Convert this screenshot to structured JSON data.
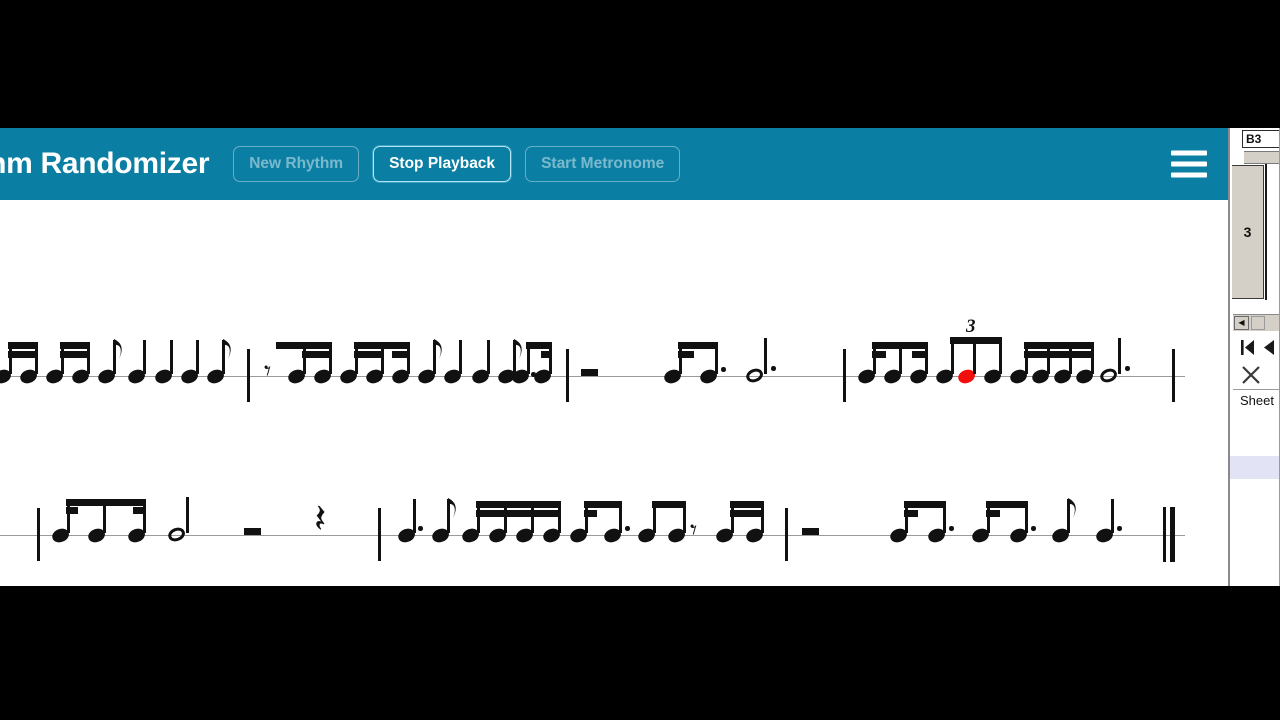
{
  "app": {
    "title": "ythm Randomizer",
    "header_color": "#0b7fa3",
    "buttons": [
      {
        "label": "New Rhythm",
        "name": "new-rhythm-button",
        "state": "idle"
      },
      {
        "label": "Stop Playback",
        "name": "stop-playback-button",
        "state": "active"
      },
      {
        "label": "Start Metronome",
        "name": "start-metronome-button",
        "state": "idle"
      }
    ],
    "menu_icon": "hamburger-menu-icon"
  },
  "score": {
    "staff_type": "single-line rhythm staff",
    "playing_note_color": "#f40d0d",
    "tuplet_label": "3",
    "systems": [
      {
        "index": 1,
        "measures": [
          "four sixteenth notes beamed, eighth note, quarter note, quarter note, quarter note, eighth note",
          "eighth rest, two sixteenths beamed, four sixteenths beamed, eighth, quarter, quarter, eighth, dotted eighth + sixteenth",
          "half rest, two eighths beamed with dot, dotted half note",
          "four sixteenths beamed, eighth-note triplet (bracket 3) with red playing note, four sixteenths beamed, dotted half note"
        ]
      },
      {
        "index": 2,
        "measures": [
          "three eighths beamed, half note, half rest, quarter rest",
          "dotted quarter, eighth, six sixteenths beamed, dotted eighth + sixteenth, two eighths beamed, eighth rest, two sixteenths beamed",
          "half rest, dotted eighth + sixteenth, dotted eighth + sixteenth, eighth note, dotted quarter note, final double barline"
        ]
      }
    ]
  },
  "background_window": {
    "type": "spreadsheet",
    "name_box": "B3",
    "row_header": "3",
    "sheet_tab": "Sheet",
    "nav_first_icon": "navigate-first-icon",
    "nav_prev_icon": "navigate-previous-icon",
    "close_icon": "close-icon",
    "scroll_left_icon": "scroll-left-icon"
  }
}
